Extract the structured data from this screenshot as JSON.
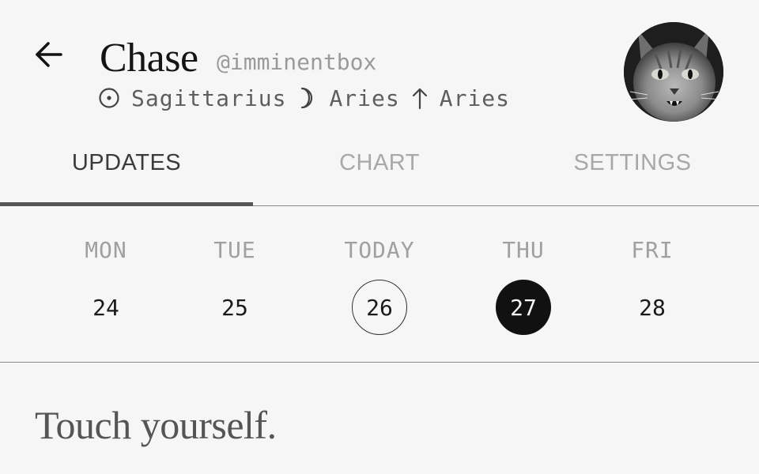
{
  "header": {
    "back_icon": "arrow-left-icon",
    "name": "Chase",
    "handle": "@imminentbox",
    "signs": [
      {
        "icon": "sun-icon",
        "sign": "Sagittarius"
      },
      {
        "icon": "moon-icon",
        "sign": "Aries"
      },
      {
        "icon": "rising-arrow-icon",
        "sign": "Aries"
      }
    ],
    "avatar_icon": "cat-avatar"
  },
  "tabs": [
    {
      "label": "UPDATES",
      "active": true
    },
    {
      "label": "CHART",
      "active": false
    },
    {
      "label": "SETTINGS",
      "active": false
    }
  ],
  "week": [
    {
      "label": "MON",
      "date": "24",
      "state": "normal"
    },
    {
      "label": "TUE",
      "date": "25",
      "state": "normal"
    },
    {
      "label": "TODAY",
      "date": "26",
      "state": "today"
    },
    {
      "label": "THU",
      "date": "27",
      "state": "selected"
    },
    {
      "label": "FRI",
      "date": "28",
      "state": "normal"
    }
  ],
  "message": "Touch yourself.",
  "colors": {
    "background": "#f6f6f6",
    "text": "#141414",
    "muted": "#a0a0a0",
    "selected_fill": "#111111"
  }
}
